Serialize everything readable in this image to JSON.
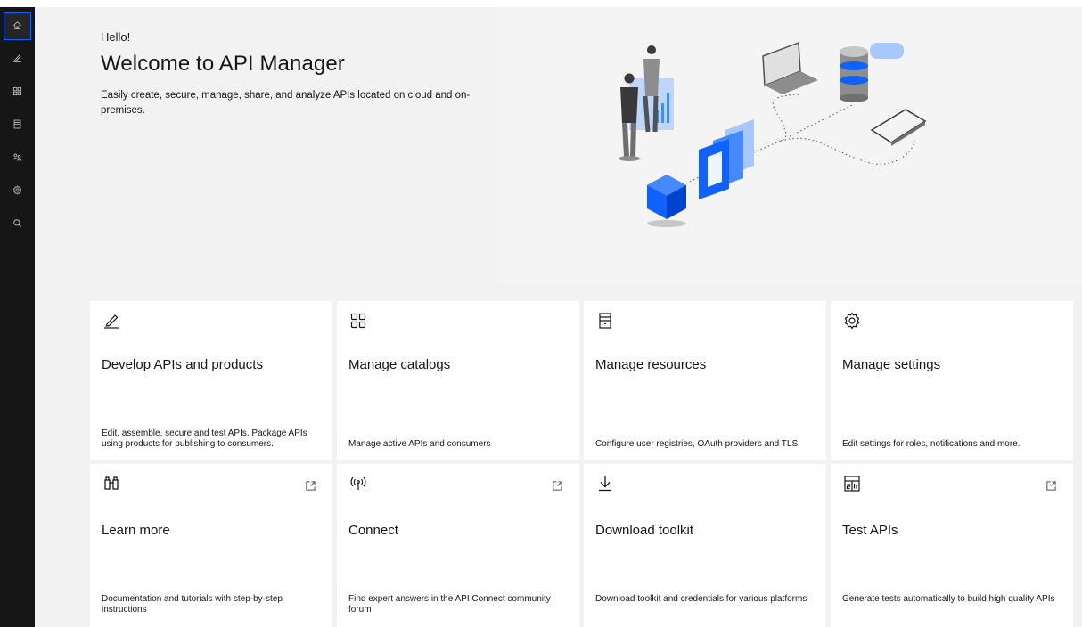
{
  "nav": {
    "items": [
      {
        "icon": "home-icon",
        "active": true
      },
      {
        "icon": "edit-icon",
        "active": false
      },
      {
        "icon": "catalog-grid-icon",
        "active": false
      },
      {
        "icon": "resources-icon",
        "active": false
      },
      {
        "icon": "users-icon",
        "active": false
      },
      {
        "icon": "settings-icon",
        "active": false
      },
      {
        "icon": "search-icon",
        "active": false
      }
    ]
  },
  "hero": {
    "greeting": "Hello!",
    "title": "Welcome to API Manager",
    "description": "Easily create, secure, manage, share, and analyze APIs located on cloud and on-premises."
  },
  "tiles": [
    {
      "icon": "edit-icon",
      "title": "Develop APIs and products",
      "description": "Edit, assemble, secure and test APIs. Package APIs using products for publishing to consumers.",
      "external": false
    },
    {
      "icon": "catalog-grid-icon",
      "title": "Manage catalogs",
      "description": "Manage active APIs and consumers",
      "external": false
    },
    {
      "icon": "resources-icon",
      "title": "Manage resources",
      "description": "Configure user registries, OAuth providers and TLS",
      "external": false
    },
    {
      "icon": "settings-icon",
      "title": "Manage settings",
      "description": "Edit settings for roles, notifications and more.",
      "external": false
    },
    {
      "icon": "binoculars-icon",
      "title": "Learn more",
      "description": "Documentation and tutorials with step-by-step instructions",
      "external": true
    },
    {
      "icon": "antenna-icon",
      "title": "Connect",
      "description": "Find expert answers in the API Connect community forum",
      "external": true
    },
    {
      "icon": "download-icon",
      "title": "Download toolkit",
      "description": "Download toolkit and credentials for various platforms",
      "external": false
    },
    {
      "icon": "test-tool-icon",
      "title": "Test APIs",
      "description": "Generate tests automatically to build high quality APIs",
      "external": true
    }
  ],
  "colors": {
    "rail": "#161616",
    "accent": "#0f62fe",
    "background": "#f2f2f2",
    "tile": "#ffffff"
  }
}
